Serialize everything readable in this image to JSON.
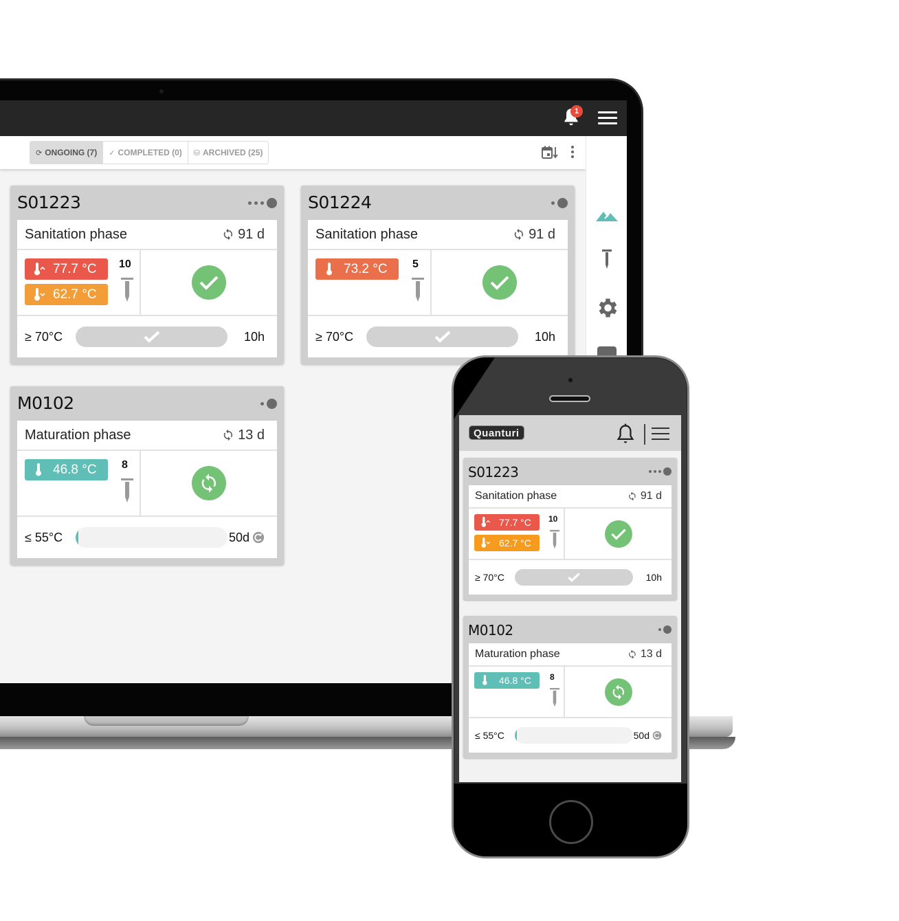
{
  "laptop": {
    "notifications": {
      "count": "1",
      "icon": "bell-icon"
    },
    "menu_icon": "hamburger-menu-icon",
    "tabs": [
      {
        "label": "ONGOING (7)",
        "icon": "sync-icon",
        "glyph": "⟳",
        "active": true
      },
      {
        "label": "COMPLETED (0)",
        "icon": "check-icon",
        "glyph": "✓",
        "active": false
      },
      {
        "label": "ARCHIVED (25)",
        "icon": "database-icon",
        "glyph": "⛁",
        "active": false
      }
    ],
    "toolbar_actions": [
      "calendar-sort-icon",
      "more-vertical-icon"
    ],
    "rail": [
      {
        "name": "mountains-icon",
        "color": "#5fbfb6"
      },
      {
        "name": "probe-icon",
        "color": "#666666"
      },
      {
        "name": "gear-icon",
        "color": "#666666"
      },
      {
        "name": "account-icon",
        "color": "#666666"
      }
    ],
    "cards": [
      {
        "id": "S01223",
        "phase": "Sanitation phase",
        "days": "91 d",
        "readings": [
          {
            "value": "77.7 °C",
            "kind": "max",
            "color": "#e9584a"
          },
          {
            "value": "62.7 °C",
            "kind": "min",
            "color": "#f29d38"
          }
        ],
        "probes": "10",
        "status": "complete",
        "threshold": "≥ 70°C",
        "progress": 1.0,
        "duration": "10h",
        "dots": 3
      },
      {
        "id": "S01224",
        "phase": "Sanitation phase",
        "days": "91 d",
        "readings": [
          {
            "value": "73.2 °C",
            "kind": "single",
            "color": "#e9704a"
          }
        ],
        "probes": "5",
        "status": "complete",
        "threshold": "≥ 70°C",
        "progress": 1.0,
        "duration": "10h",
        "dots": 1
      },
      {
        "id": "M0102",
        "phase": "Maturation phase",
        "days": "13 d",
        "readings": [
          {
            "value": "46.8 °C",
            "kind": "single",
            "color": "#5fbfb6"
          }
        ],
        "probes": "8",
        "status": "in-progress",
        "threshold": "≤ 55°C",
        "progress": 0.02,
        "duration": "50d",
        "dots": 1
      }
    ]
  },
  "phone": {
    "logo": "Quanturi",
    "bell_icon": "bell-outline-icon",
    "menu_icon": "hamburger-menu-icon",
    "cards": [
      {
        "id": "S01223",
        "phase": "Sanitation phase",
        "days": "91 d",
        "readings": [
          {
            "value": "77.7 °C",
            "kind": "max",
            "color": "#e9584a"
          },
          {
            "value": "62.7 °C",
            "kind": "min",
            "color": "#f79b1e"
          }
        ],
        "probes": "10",
        "status": "complete",
        "threshold": "≥ 70°C",
        "progress": 1.0,
        "duration": "10h",
        "dots": 3
      },
      {
        "id": "M0102",
        "phase": "Maturation phase",
        "days": "13 d",
        "readings": [
          {
            "value": "46.8 °C",
            "kind": "single",
            "color": "#5fbfb6"
          }
        ],
        "probes": "8",
        "status": "in-progress",
        "threshold": "≤ 55°C",
        "progress": 0.02,
        "duration": "50d",
        "dots": 1
      }
    ]
  },
  "colors": {
    "status_green": "#73c276",
    "accent_teal": "#5fbfb6",
    "badge_red": "#e84b3c",
    "topbar": "#262626"
  }
}
